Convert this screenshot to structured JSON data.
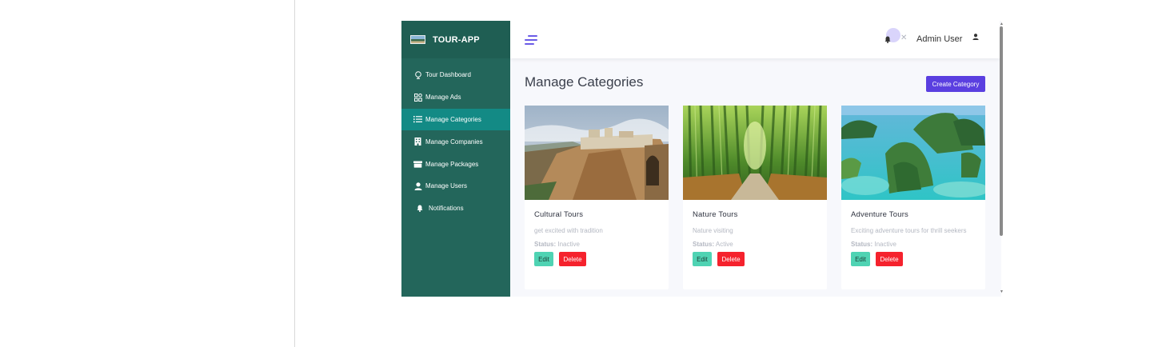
{
  "brand": {
    "name": "TOUR-APP"
  },
  "sidebar": {
    "items": [
      {
        "label": "Tour Dashboard",
        "icon": "globe-icon",
        "active": false
      },
      {
        "label": "Manage Ads",
        "icon": "grid-icon",
        "active": false
      },
      {
        "label": "Manage Categories",
        "icon": "list-icon",
        "active": true
      },
      {
        "label": "Manage Companies",
        "icon": "building-icon",
        "active": false
      },
      {
        "label": "Manage Packages",
        "icon": "package-icon",
        "active": false
      },
      {
        "label": "Manage Users",
        "icon": "user-icon",
        "active": false
      },
      {
        "label": "Notifications",
        "icon": "bell-icon",
        "active": false
      }
    ]
  },
  "topbar": {
    "user_name": "Admin User"
  },
  "page": {
    "title": "Manage Categories",
    "create_label": "Create Category"
  },
  "cards": [
    {
      "title": "Cultural Tours",
      "description": "get excited with tradition",
      "status_label": "Status:",
      "status": "Inactive",
      "edit_label": "Edit",
      "delete_label": "Delete"
    },
    {
      "title": "Nature Tours",
      "description": "Nature visiting",
      "status_label": "Status:",
      "status": "Active",
      "edit_label": "Edit",
      "delete_label": "Delete"
    },
    {
      "title": "Adventure Tours",
      "description": "Exciting adventure tours for thrill seekers",
      "status_label": "Status:",
      "status": "Inactive",
      "edit_label": "Edit",
      "delete_label": "Delete"
    }
  ],
  "colors": {
    "sidebar": "#23665b",
    "sidebar_active": "#138a85",
    "primary": "#5a3fe0",
    "edit": "#4fd3b3",
    "delete": "#f5222d"
  }
}
